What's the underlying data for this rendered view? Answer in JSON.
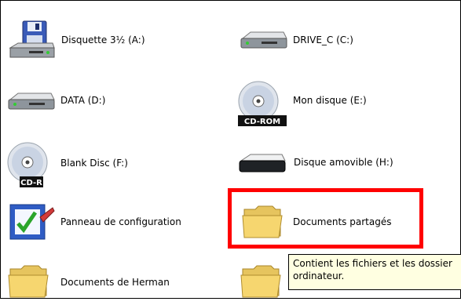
{
  "items": [
    {
      "label": "Disquette 3½ (A:)",
      "icon": "floppy-drive-icon"
    },
    {
      "label": "DRIVE_C (C:)",
      "icon": "hard-drive-icon"
    },
    {
      "label": "DATA (D:)",
      "icon": "hard-drive-icon"
    },
    {
      "label": "Mon disque (E:)",
      "icon": "cd-rom-drive-icon",
      "badge": "CD-ROM"
    },
    {
      "label": "Blank Disc (F:)",
      "icon": "cd-r-drive-icon",
      "badge": "CD-R"
    },
    {
      "label": "Disque amovible (H:)",
      "icon": "removable-disk-icon"
    },
    {
      "label": "Panneau de configuration",
      "icon": "control-panel-icon"
    },
    {
      "label": "Documents partagés",
      "icon": "folder-icon"
    },
    {
      "label": "Documents de Herman",
      "icon": "folder-icon"
    }
  ],
  "tooltip": {
    "line1": "Contient les fichiers et les dossier",
    "line2": "ordinateur."
  },
  "colors": {
    "highlight": "#ff0000",
    "tooltip_bg": "#ffffe1",
    "folder": "#f6d66f"
  }
}
